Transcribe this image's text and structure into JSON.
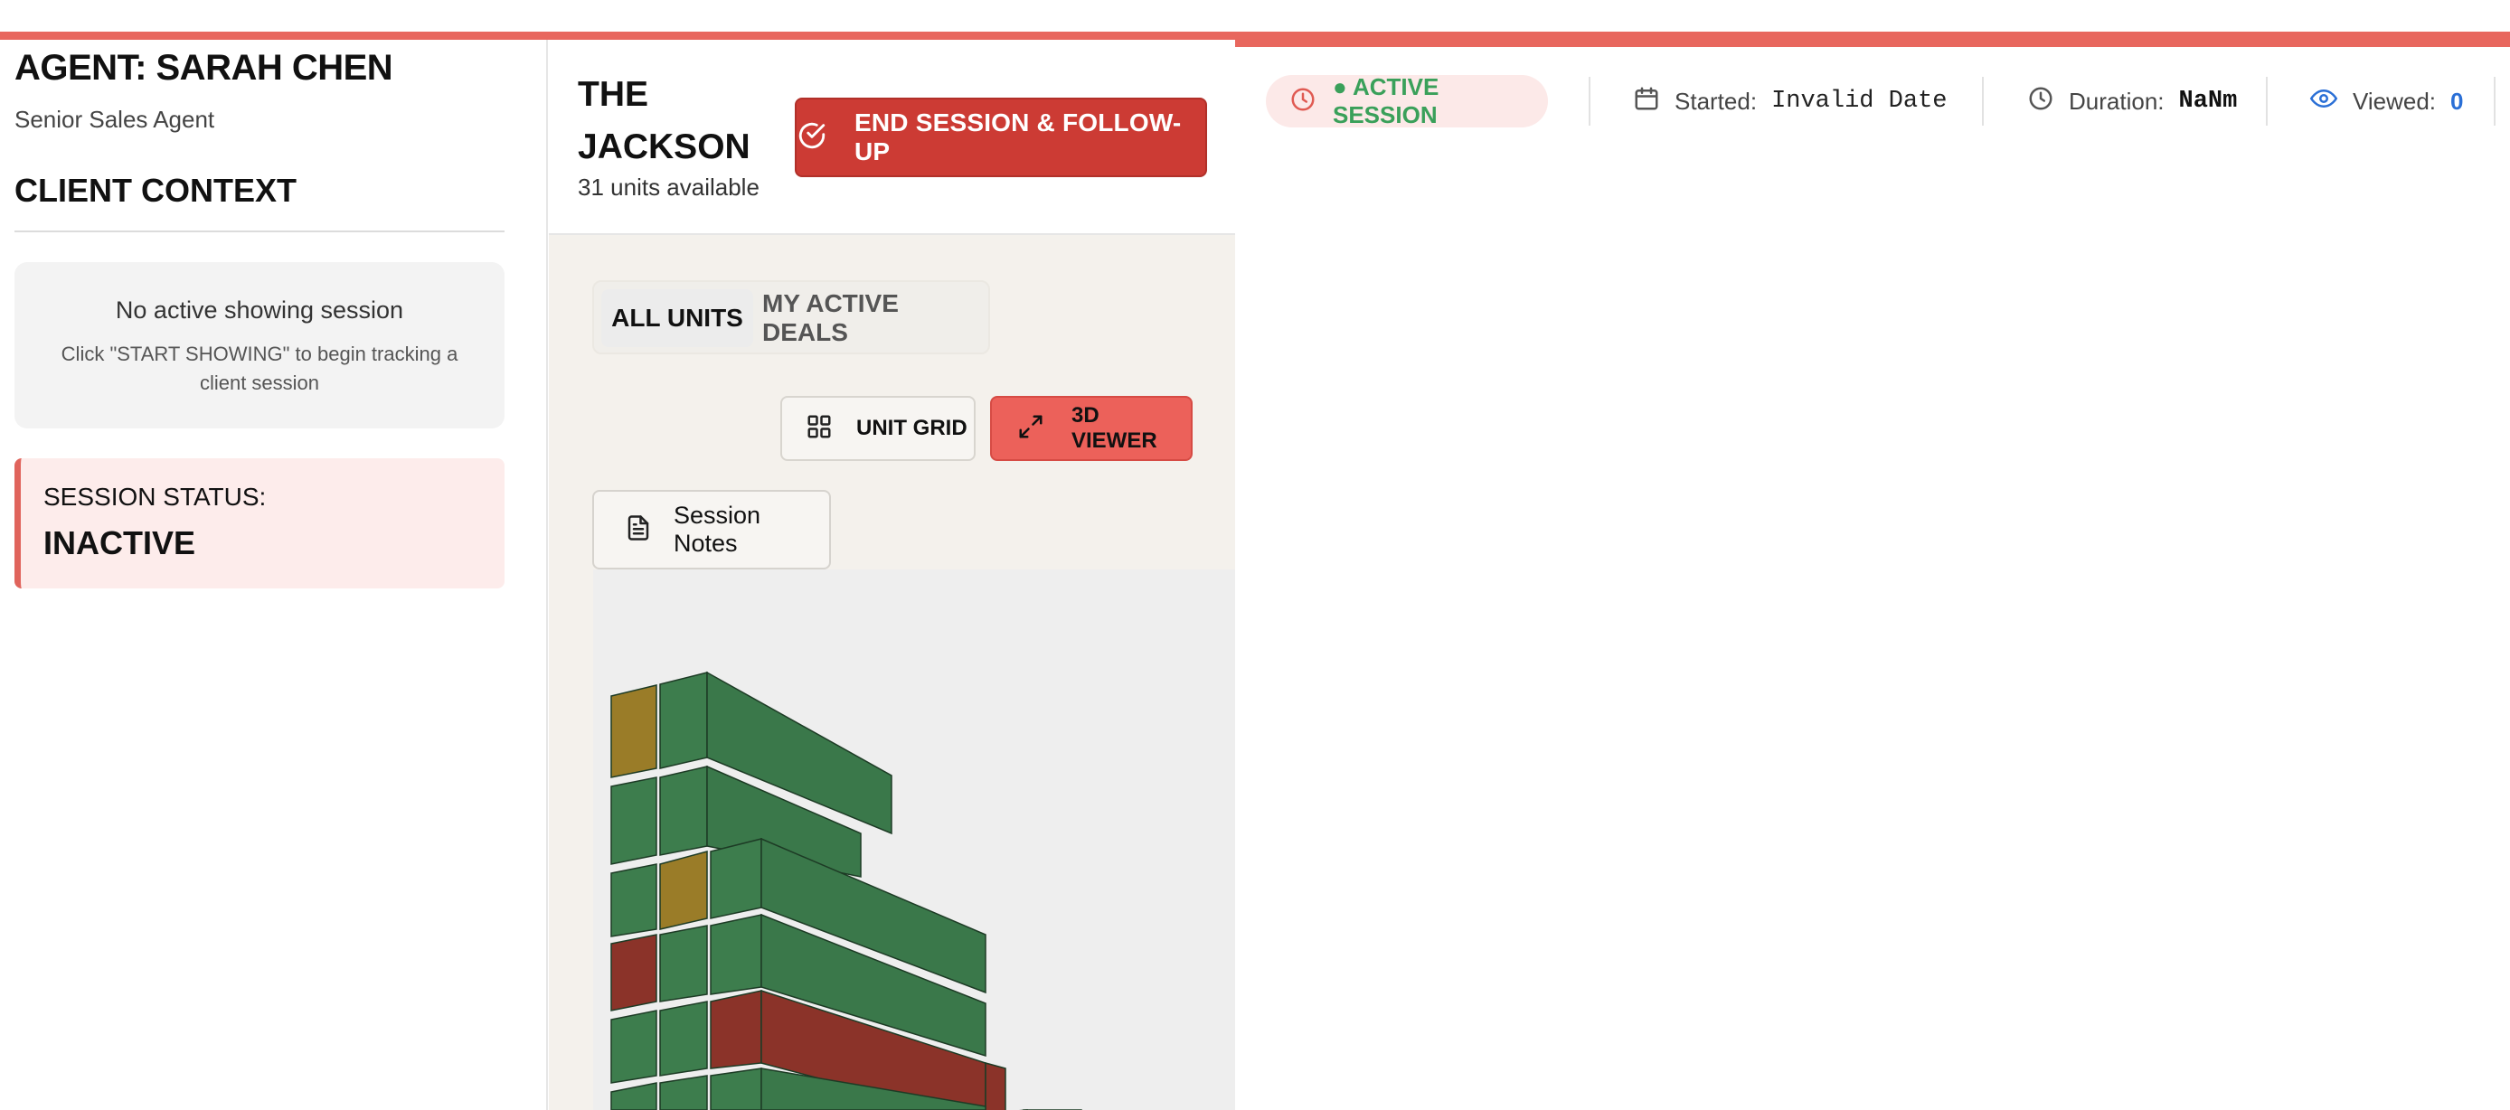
{
  "colors": {
    "accent": "#e8675e",
    "danger": "#cc3b34",
    "active_green": "#3aa05a",
    "available_unit": "#3d7d4d",
    "held_unit": "#a88a2a",
    "sold_unit": "#8b3329"
  },
  "sidebar": {
    "agent_name": "AGENT: SARAH CHEN",
    "agent_role": "Senior Sales Agent",
    "client_context_title": "CLIENT CONTEXT",
    "no_session_title": "No active showing session",
    "no_session_hint": "Click \"START SHOWING\" to begin tracking a client session",
    "status_label": "SESSION STATUS:",
    "status_value": "INACTIVE"
  },
  "building": {
    "name": "THE JACKSON",
    "units_available": "31 units available",
    "end_session_label": "END SESSION & FOLLOW-UP"
  },
  "tabs": [
    {
      "label": "ALL UNITS",
      "active": true
    },
    {
      "label": "MY ACTIVE DEALS",
      "active": false
    }
  ],
  "view_buttons": {
    "grid_label": "UNIT GRID",
    "viewer_label": "3D VIEWER"
  },
  "notes_label": "Session Notes",
  "infobar": {
    "active_label": "● ACTIVE SESSION",
    "started_label": "Started:",
    "started_value": "Invalid Date",
    "duration_label": "Duration:",
    "duration_value": "NaNm",
    "viewed_label": "Viewed:",
    "viewed_value": "0"
  },
  "icons": [
    "clock-icon",
    "calendar-icon",
    "eye-icon",
    "check-circle-icon",
    "grid-icon",
    "expand-icon",
    "document-icon"
  ]
}
